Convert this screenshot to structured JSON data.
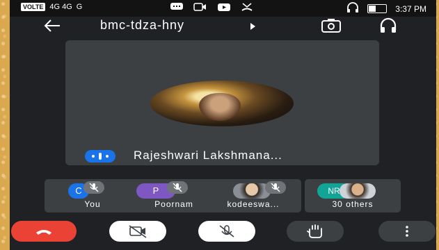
{
  "status_bar": {
    "volte": "VOLTE",
    "network": "4G 4G",
    "signal": "G",
    "time": "3:37 PM"
  },
  "meeting": {
    "code": "bmc-tdza-hny",
    "active_speaker": "Rajeshwari Lakshmana..."
  },
  "participants": [
    {
      "label": "You",
      "initials": "C",
      "avatar_color": "#1a73e8",
      "muted": true
    },
    {
      "label": "Poornam",
      "initials": "P",
      "avatar_color": "#7e57c2",
      "muted": true
    },
    {
      "label": "kodeeswa...",
      "initials": "",
      "avatar_color": "#9e9e9e",
      "muted": true
    },
    {
      "label": "30 others",
      "initials": "NR",
      "avatar_color": "#12a597",
      "muted": false
    }
  ],
  "controls": {
    "end_call_color": "#ea4335",
    "button_color": "#ffffff",
    "secondary_color": "#3c4043"
  }
}
